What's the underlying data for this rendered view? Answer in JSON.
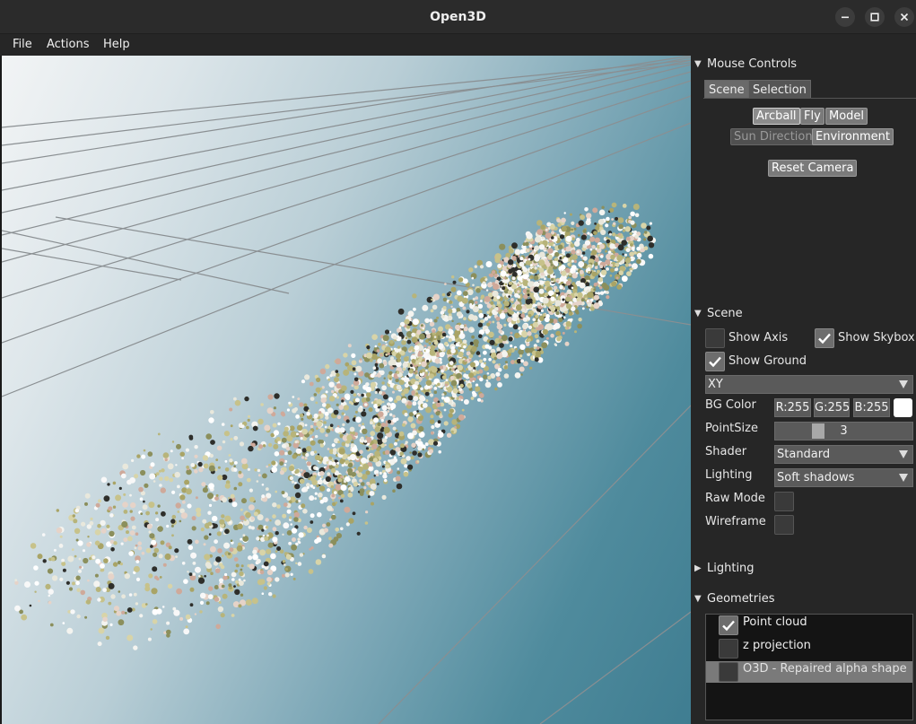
{
  "window": {
    "title": "Open3D"
  },
  "menu": [
    "File",
    "Actions",
    "Help"
  ],
  "mouse_controls": {
    "header": "Mouse Controls",
    "tabs": [
      "Scene",
      "Selection"
    ],
    "modes": [
      "Arcball",
      "Fly",
      "Model"
    ],
    "modes2": [
      "Sun Direction",
      "Environment"
    ],
    "reset": "Reset Camera"
  },
  "scene": {
    "header": "Scene",
    "show_axis": {
      "label": "Show Axis",
      "checked": false
    },
    "show_skybox": {
      "label": "Show Skybox",
      "checked": true
    },
    "show_ground": {
      "label": "Show Ground",
      "checked": true
    },
    "ground_plane": "XY",
    "bg_color": {
      "label": "BG Color",
      "r": "R:255",
      "g": "G:255",
      "b": "B:255",
      "swatch": "#ffffff"
    },
    "point_size": {
      "label": "PointSize",
      "value": 3,
      "min": 1,
      "max": 10
    },
    "shader": {
      "label": "Shader",
      "value": "Standard"
    },
    "lighting": {
      "label": "Lighting",
      "value": "Soft shadows"
    },
    "raw_mode": {
      "label": "Raw Mode",
      "checked": false
    },
    "wireframe": {
      "label": "Wireframe",
      "checked": false
    }
  },
  "lighting_section": {
    "header": "Lighting"
  },
  "geometries": {
    "header": "Geometries",
    "items": [
      {
        "label": "Point cloud",
        "checked": true,
        "selected": false
      },
      {
        "label": "z projection",
        "checked": false,
        "selected": false
      },
      {
        "label": "O3D - Repaired alpha shape",
        "checked": false,
        "selected": true
      }
    ]
  }
}
